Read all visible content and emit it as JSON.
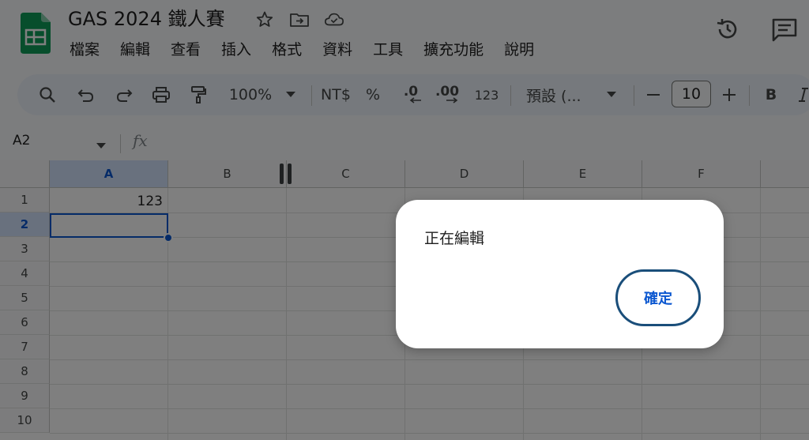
{
  "app": {
    "title": "GAS 2024 鐵人賽"
  },
  "menu": [
    "檔案",
    "編輯",
    "查看",
    "插入",
    "格式",
    "資料",
    "工具",
    "擴充功能",
    "說明"
  ],
  "toolbar": {
    "zoom": "100%",
    "currency": "NT$",
    "percent": "%",
    "decrease_decimal": ".0",
    "increase_decimal": ".00",
    "number_format": "123",
    "font": "預設 (...",
    "font_size": "10",
    "bold": "B"
  },
  "formula_bar": {
    "name_box": "A2",
    "fx": "fx"
  },
  "grid": {
    "columns": [
      "A",
      "B",
      "C",
      "D",
      "E",
      "F"
    ],
    "rows": [
      "1",
      "2",
      "3",
      "4",
      "5",
      "6",
      "7",
      "8",
      "9",
      "10"
    ],
    "cells": {
      "A1": "123"
    },
    "selected_cell": "A2"
  },
  "dialog": {
    "message": "正在編輯",
    "ok_label": "確定"
  },
  "colors": {
    "accent": "#0b57d0",
    "selection_header": "#d3e3fd",
    "toolbar_bg": "#edf2fa",
    "sheets_green": "#0f9d58"
  }
}
